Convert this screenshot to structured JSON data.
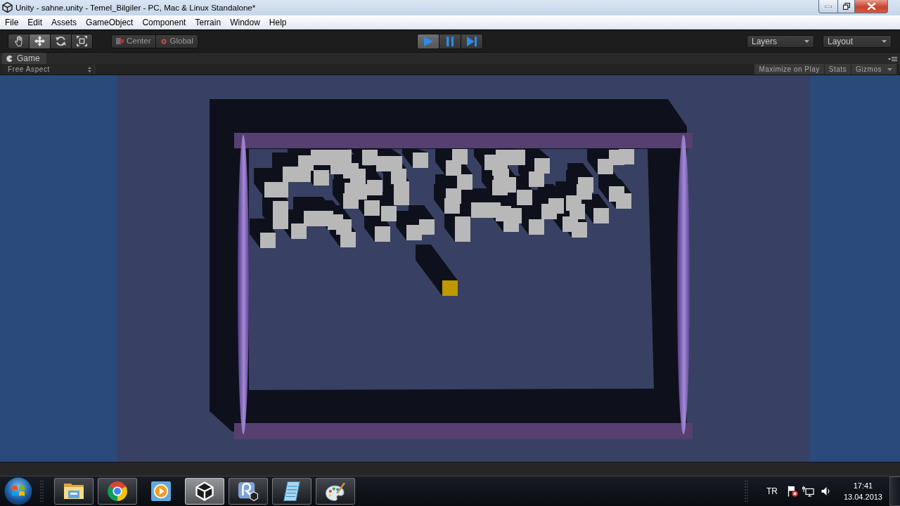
{
  "window": {
    "title": "Unity - sahne.unity - Temel_Bilgiler - PC, Mac & Linux Standalone*"
  },
  "menu": [
    {
      "label": "File"
    },
    {
      "label": "Edit"
    },
    {
      "label": "Assets"
    },
    {
      "label": "GameObject"
    },
    {
      "label": "Component"
    },
    {
      "label": "Terrain"
    },
    {
      "label": "Window"
    },
    {
      "label": "Help"
    }
  ],
  "toolbar": {
    "tools": [
      {
        "kind": "hand",
        "selected": false
      },
      {
        "kind": "move",
        "selected": true
      },
      {
        "kind": "rotate",
        "selected": false
      },
      {
        "kind": "scale",
        "selected": false
      }
    ],
    "pivot": [
      {
        "kind": "center",
        "label": "Center"
      },
      {
        "kind": "global",
        "label": "Global"
      }
    ],
    "playback": [
      {
        "kind": "play",
        "selected": true
      },
      {
        "kind": "pause",
        "selected": false
      },
      {
        "kind": "step",
        "selected": false
      }
    ],
    "dropdowns": [
      {
        "label": "Layers"
      },
      {
        "label": "Layout"
      }
    ]
  },
  "game_panel": {
    "tabs": [
      {
        "label": "Game",
        "selected": true
      }
    ],
    "aspect": "Free Aspect",
    "options": [
      {
        "label": "Maximize on Play",
        "dropdown": false
      },
      {
        "label": "Stats",
        "dropdown": false
      },
      {
        "label": "Gizmos",
        "dropdown": true
      }
    ]
  },
  "taskbar": {
    "apps": [
      {
        "kind": "folder",
        "running": true,
        "selected": false
      },
      {
        "kind": "browser",
        "running": true,
        "selected": false
      },
      {
        "kind": "player",
        "running": false,
        "selected": false
      },
      {
        "kind": "engine",
        "running": true,
        "selected": true
      },
      {
        "kind": "script_editor",
        "running": true,
        "selected": false
      },
      {
        "kind": "notepad",
        "running": true,
        "selected": false
      },
      {
        "kind": "paint",
        "running": true,
        "selected": false
      }
    ],
    "language": "TR",
    "time": "17:41",
    "date": "13.04.2013"
  }
}
